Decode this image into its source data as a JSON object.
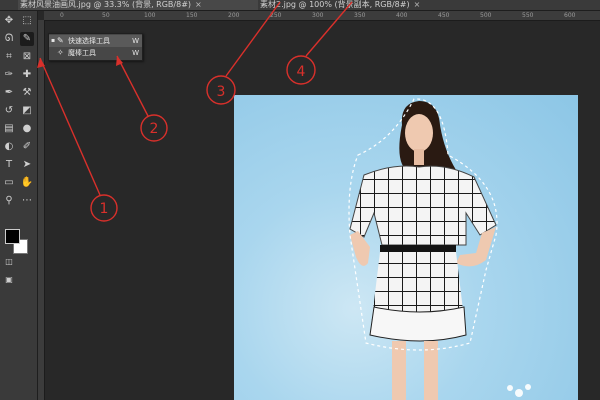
{
  "tabs": [
    {
      "label": "素材风景油画风.jpg @ 33.3% (背景, RGB/8#)",
      "close": "×",
      "active": true
    },
    {
      "label": "素材2.jpg @ 100% (背景副本, RGB/8#)",
      "close": "×",
      "active": false
    }
  ],
  "ruler_ticks": [
    "0",
    "50",
    "100",
    "150",
    "200",
    "250",
    "300",
    "350",
    "400",
    "450",
    "500",
    "550",
    "600"
  ],
  "tools": [
    {
      "name": "move-tool",
      "glyph": "✥"
    },
    {
      "name": "marquee-tool",
      "glyph": "⬚"
    },
    {
      "name": "lasso-tool",
      "glyph": "ᘏ"
    },
    {
      "name": "quick-selection-tool",
      "glyph": "✎"
    },
    {
      "name": "crop-tool",
      "glyph": "⌗"
    },
    {
      "name": "frame-tool",
      "glyph": "⊠"
    },
    {
      "name": "eyedropper-tool",
      "glyph": "✑"
    },
    {
      "name": "healing-brush-tool",
      "glyph": "✚"
    },
    {
      "name": "brush-tool",
      "glyph": "✒"
    },
    {
      "name": "stamp-tool",
      "glyph": "⚒"
    },
    {
      "name": "history-brush-tool",
      "glyph": "↺"
    },
    {
      "name": "eraser-tool",
      "glyph": "◩"
    },
    {
      "name": "gradient-tool",
      "glyph": "▤"
    },
    {
      "name": "blur-tool",
      "glyph": "●"
    },
    {
      "name": "dodge-tool",
      "glyph": "◐"
    },
    {
      "name": "pen-tool",
      "glyph": "✐"
    },
    {
      "name": "type-tool",
      "glyph": "T"
    },
    {
      "name": "path-selection-tool",
      "glyph": "➤"
    },
    {
      "name": "shape-tool",
      "glyph": "▭"
    },
    {
      "name": "hand-tool",
      "glyph": "✋"
    },
    {
      "name": "zoom-tool",
      "glyph": "⚲"
    },
    {
      "name": "more-tools",
      "glyph": "⋯"
    }
  ],
  "flyout": [
    {
      "label": "快速选择工具",
      "key": "W",
      "check": "▪",
      "icon": "✎",
      "selected": true
    },
    {
      "label": "魔棒工具",
      "key": "W",
      "check": "",
      "icon": "✧",
      "selected": false
    }
  ],
  "callouts": [
    "1",
    "2",
    "3",
    "4"
  ],
  "colors": {
    "annotation": "#d9302b",
    "photo_bg": "#a9d6ee",
    "canvas_bg": "#282828"
  }
}
